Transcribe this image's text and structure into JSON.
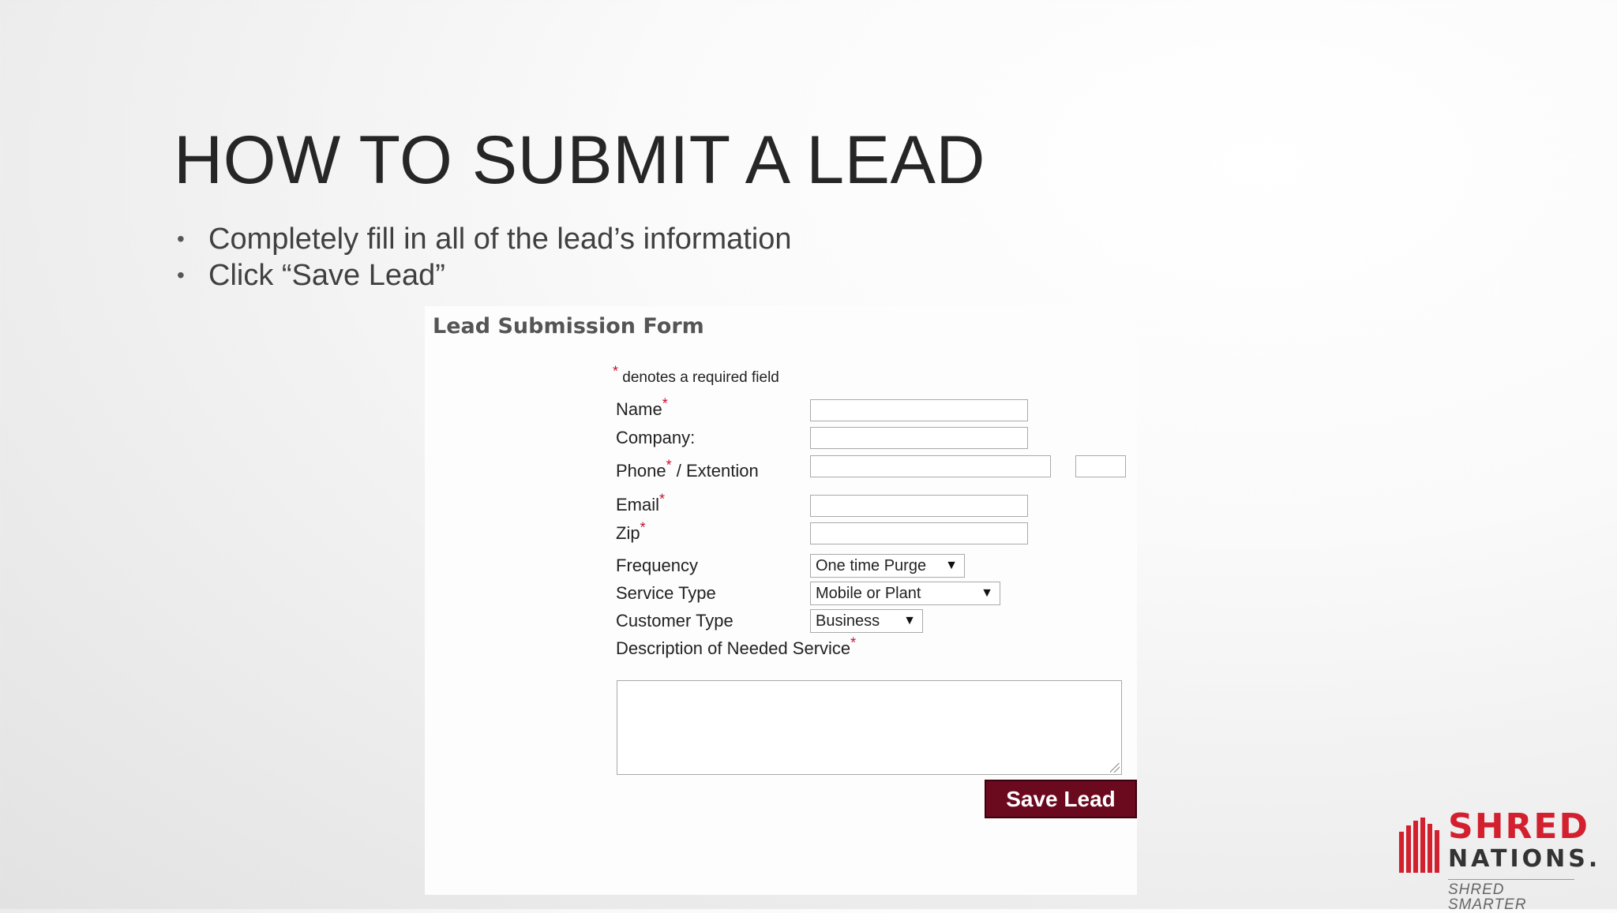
{
  "slide": {
    "title": "HOW TO SUBMIT A LEAD",
    "bullets": [
      "Completely fill in all of the lead’s information",
      "Click “Save Lead”"
    ]
  },
  "form": {
    "title": "Lead Submission Form",
    "required_star": "*",
    "required_note": "denotes a required field",
    "fields": {
      "name_label": "Name",
      "company_label": "Company:",
      "phone_label": "Phone",
      "extension_label": "/ Extention",
      "email_label": "Email",
      "zip_label": "Zip",
      "frequency_label": "Frequency",
      "service_type_label": "Service Type",
      "customer_type_label": "Customer Type",
      "description_label": "Description of Needed Service"
    },
    "values": {
      "name": "",
      "company": "",
      "phone": "",
      "extension": "",
      "email": "",
      "zip": "",
      "description": ""
    },
    "selects": {
      "frequency": "One time Purge",
      "service_type": "Mobile or Plant",
      "customer_type": "Business"
    },
    "save_button": "Save Lead"
  },
  "logo": {
    "line1": "SHRED",
    "line2": "NATIONS.",
    "tagline": "SHRED SMARTER",
    "colors": {
      "red": "#d3202f",
      "dark": "#333333"
    }
  },
  "colors": {
    "button_bg": "#6b0a1f",
    "required_star": "#c8102e"
  }
}
